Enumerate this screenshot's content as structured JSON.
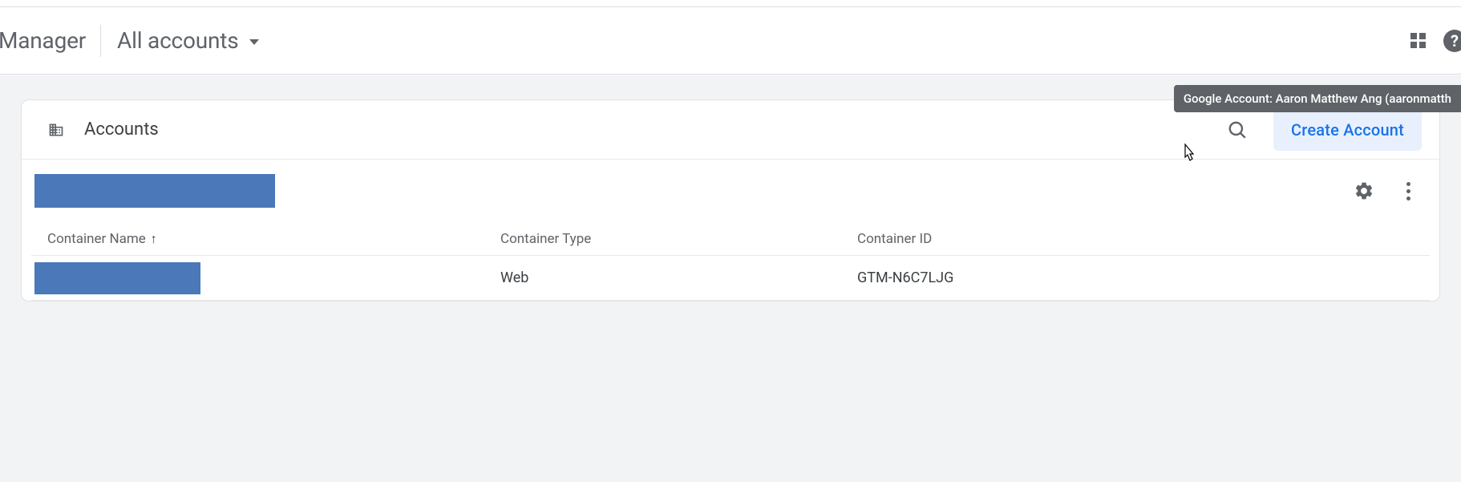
{
  "header": {
    "brand_suffix": "Manager",
    "account_switcher_label": "All accounts"
  },
  "tooltip": {
    "text": "Google Account: Aaron Matthew Ang (aaronmatth"
  },
  "card": {
    "title": "Accounts",
    "create_button_label": "Create Account"
  },
  "table": {
    "columns": {
      "name": "Container Name",
      "type": "Container Type",
      "id": "Container ID"
    },
    "sort_indicator": "↑",
    "rows": [
      {
        "name_redacted": true,
        "type": "Web",
        "id": "GTM-N6C7LJG"
      }
    ]
  }
}
